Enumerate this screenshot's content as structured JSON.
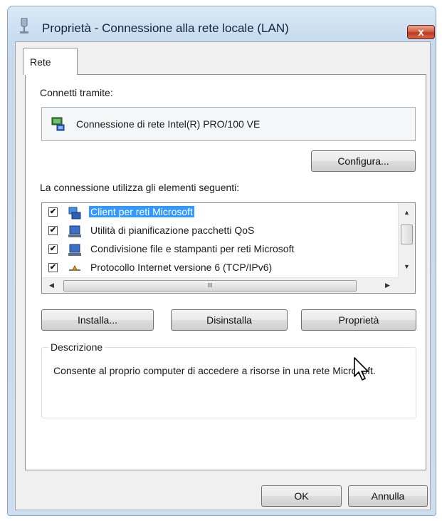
{
  "window": {
    "title": "Proprietà - Connessione alla rete locale (LAN)",
    "close_label": "x"
  },
  "tabs": [
    {
      "label": "Rete"
    }
  ],
  "connect_via": {
    "label": "Connetti tramite:",
    "adapter_name": "Connessione di rete Intel(R) PRO/100 VE",
    "configure_label": "Configura..."
  },
  "items": {
    "label": "La connessione utilizza gli elementi seguenti:",
    "list": [
      {
        "label": "Client per reti Microsoft",
        "checked": true,
        "selected": true,
        "icon": "network-client-icon"
      },
      {
        "label": "Utilità di pianificazione pacchetti QoS",
        "checked": true,
        "selected": false,
        "icon": "service-icon"
      },
      {
        "label": "Condivisione file e stampanti per reti Microsoft",
        "checked": true,
        "selected": false,
        "icon": "service-icon"
      },
      {
        "label": "Protocollo Internet versione 6 (TCP/IPv6)",
        "checked": true,
        "selected": false,
        "icon": "protocol-icon"
      }
    ],
    "hscroll_grip": "III"
  },
  "buttons": {
    "install": "Installa...",
    "uninstall": "Disinstalla",
    "properties": "Proprietà",
    "ok": "OK",
    "cancel": "Annulla"
  },
  "description": {
    "legend": "Descrizione",
    "text": "Consente al proprio computer di accedere a risorse in una rete Microsoft."
  },
  "check_mark": "✔",
  "colors": {
    "selection": "#3399ff",
    "close_button": "#c0391c",
    "title_bar": "#c8dcef"
  }
}
